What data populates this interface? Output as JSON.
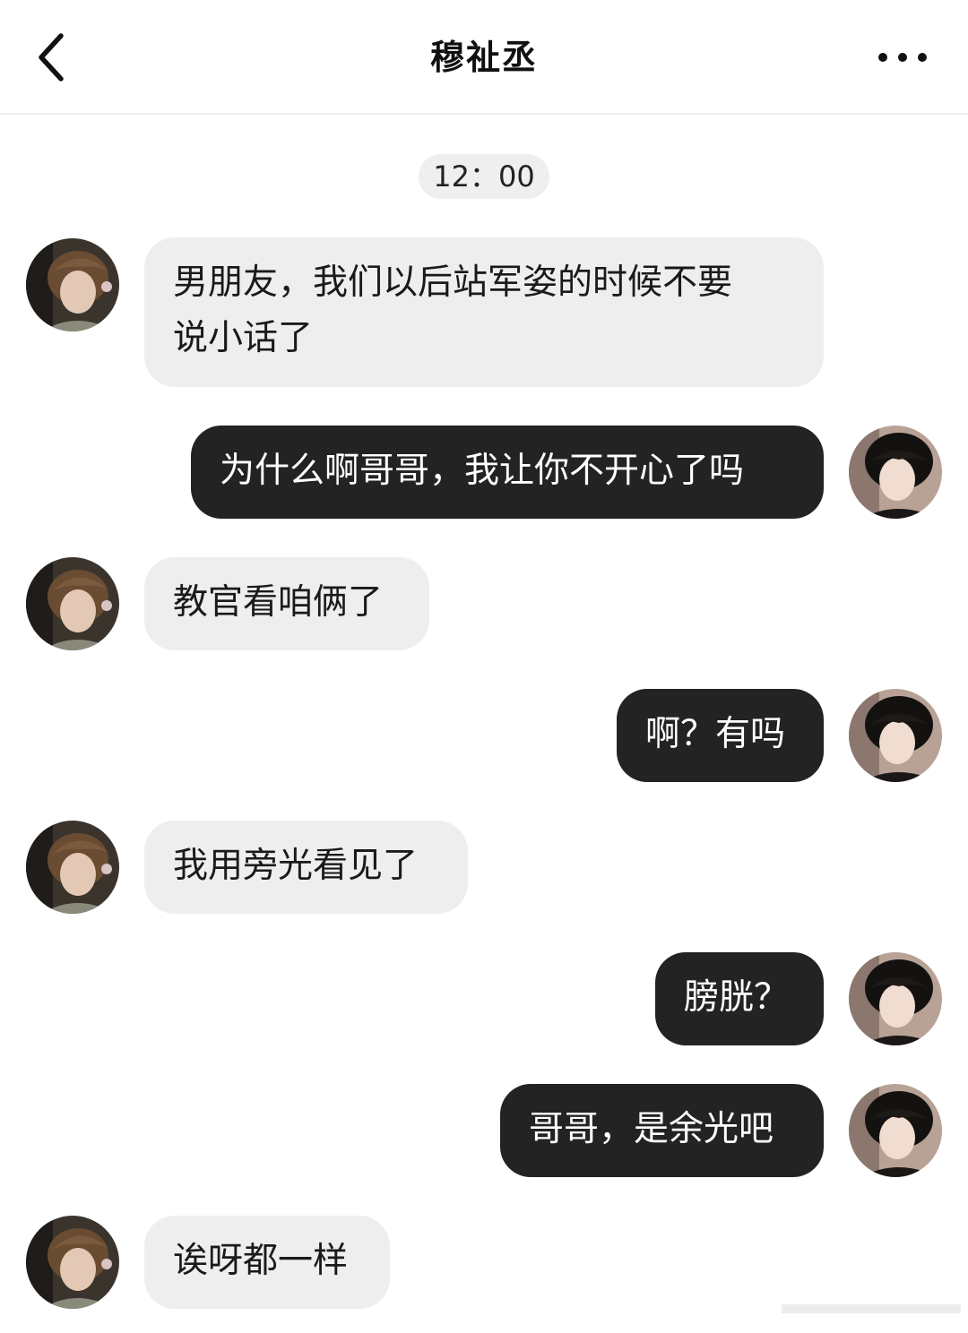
{
  "header": {
    "title": "穆祉丞",
    "back_icon": "chevron-left-icon",
    "more_icon": "ellipsis-horizontal-icon"
  },
  "timestamp": "12：00",
  "colors": {
    "incoming_bubble": "#eeeeee",
    "outgoing_bubble": "#232323",
    "timestamp_pill": "#efefef"
  },
  "messages": [
    {
      "side": "incoming",
      "text": "男朋友，我们以后站军姿的时候不要\n说小话了"
    },
    {
      "side": "outgoing",
      "text": "为什么啊哥哥，我让你不开心了吗"
    },
    {
      "side": "incoming",
      "text": "教官看咱俩了"
    },
    {
      "side": "outgoing",
      "text": "啊？有吗"
    },
    {
      "side": "incoming",
      "text": "我用旁光看见了"
    },
    {
      "side": "outgoing",
      "text": "膀胱？"
    },
    {
      "side": "outgoing",
      "text": "哥哥，是余光吧"
    },
    {
      "side": "incoming",
      "text": "诶呀都一样"
    }
  ]
}
